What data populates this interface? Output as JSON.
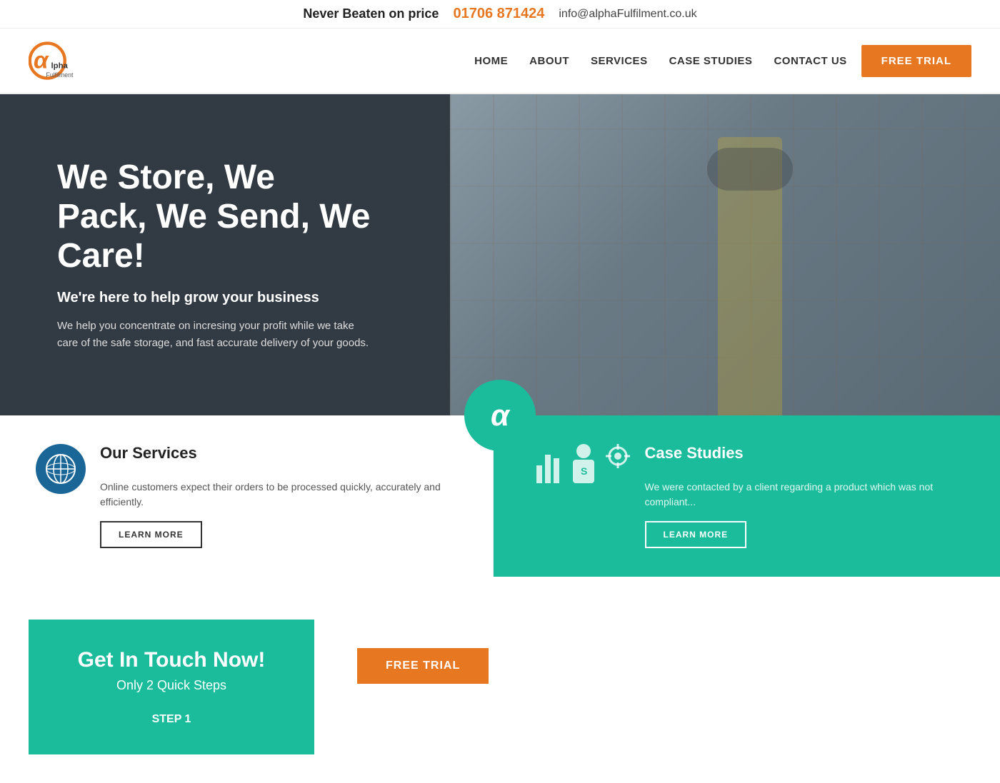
{
  "topbar": {
    "tagline": "Never Beaten on price",
    "phone": "01706 871424",
    "email": "info@alphaFulfilment.co.uk"
  },
  "nav": {
    "logo_text": "Fulfilment",
    "links": [
      {
        "label": "HOME",
        "id": "home"
      },
      {
        "label": "ABOUT",
        "id": "about"
      },
      {
        "label": "SERVICES",
        "id": "services"
      },
      {
        "label": "CASE STUDIES",
        "id": "case-studies"
      },
      {
        "label": "CONTACT US",
        "id": "contact"
      }
    ],
    "cta_label": "FREE TRIAL"
  },
  "hero": {
    "heading": "We Store, We Pack, We Send, We Care!",
    "subheading": "We're here to help grow your business",
    "body": "We help you concentrate on incresing your profit while we take care of the safe storage, and fast accurate delivery of your goods."
  },
  "services": {
    "heading": "Our Services",
    "body": "Online customers expect their orders to be processed quickly, accurately and efficiently.",
    "learn_more": "LEARN MORE"
  },
  "case_studies": {
    "heading": "Case Studies",
    "body": "We were contacted by a client regarding a product which was not compliant...",
    "learn_more": "LEARN MORE"
  },
  "get_in_touch": {
    "heading": "Get In Touch Now!",
    "subheading": "Only 2 Quick Steps",
    "step_label": "STEP 1"
  },
  "free_trial_bottom": {
    "label": "FREE TRIAL"
  }
}
